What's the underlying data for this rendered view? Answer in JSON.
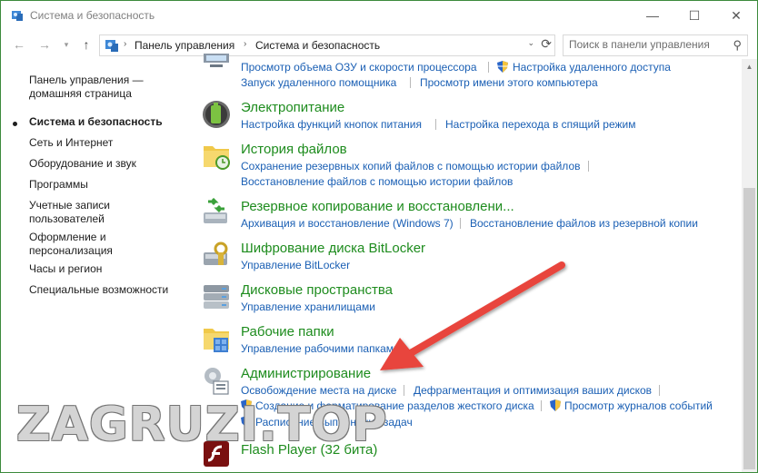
{
  "window": {
    "title": "Система и безопасность",
    "controls": {
      "minimize": "—",
      "maximize": "☐",
      "close": "✕"
    },
    "accent_border": "#3c8a3c"
  },
  "nav": {
    "back": "←",
    "forward": "→",
    "up": "↑",
    "breadcrumb": [
      "Панель управления",
      "Система и безопасность"
    ],
    "search_placeholder": "Поиск в панели управления"
  },
  "sidebar": {
    "items": [
      {
        "label_lines": [
          "Панель управления —",
          "домашняя страница"
        ],
        "active": false
      },
      {
        "label_lines": [
          "Система и безопасность"
        ],
        "active": true
      },
      {
        "label_lines": [
          "Сеть и Интернет"
        ],
        "active": false
      },
      {
        "label_lines": [
          "Оборудование и звук"
        ],
        "active": false
      },
      {
        "label_lines": [
          "Программы"
        ],
        "active": false
      },
      {
        "label_lines": [
          "Учетные записи",
          "пользователей"
        ],
        "active": false
      },
      {
        "label_lines": [
          "Оформление и",
          "персонализация"
        ],
        "active": false
      },
      {
        "label_lines": [
          "Часы и регион"
        ],
        "active": false
      },
      {
        "label_lines": [
          "Специальные возможности"
        ],
        "active": false
      }
    ]
  },
  "categories": [
    {
      "id": "system",
      "title": "",
      "icon": "system-monitor-icon",
      "links": [
        "Просмотр объема ОЗУ и скорости процессора",
        "Настройка удаленного доступа",
        "Запуск удаленного помощника",
        "Просмотр имени этого компьютера"
      ]
    },
    {
      "id": "power",
      "title": "Электропитание",
      "icon": "battery-icon",
      "links": [
        "Настройка функций кнопок питания",
        "Настройка перехода в спящий режим"
      ]
    },
    {
      "id": "file-history",
      "title": "История файлов",
      "icon": "file-history-icon",
      "links": [
        "Сохранение резервных копий файлов с помощью истории файлов",
        "Восстановление файлов с помощью истории файлов"
      ]
    },
    {
      "id": "backup",
      "title": "Резервное копирование и восстановлени...",
      "icon": "backup-restore-icon",
      "links": [
        "Архивация и восстановление (Windows 7)",
        "Восстановление файлов из резервной копии"
      ]
    },
    {
      "id": "bitlocker",
      "title": "Шифрование диска BitLocker",
      "icon": "bitlocker-icon",
      "links": [
        "Управление BitLocker"
      ]
    },
    {
      "id": "storage",
      "title": "Дисковые пространства",
      "icon": "storage-spaces-icon",
      "links": [
        "Управление хранилищами"
      ]
    },
    {
      "id": "work-folders",
      "title": "Рабочие папки",
      "icon": "work-folders-icon",
      "links": [
        "Управление рабочими папками"
      ]
    },
    {
      "id": "admin",
      "title": "Администрирование",
      "icon": "admin-tools-icon",
      "links": [
        "Освобождение места на диске",
        "Дефрагментация и оптимизация ваших дисков",
        "Создание и форматирование разделов жесткого диска",
        "Просмотр журналов событий",
        "Расписание выполнения задач"
      ]
    },
    {
      "id": "flash",
      "title": "Flash Player (32 бита)",
      "icon": "flash-player-icon",
      "links": []
    }
  ],
  "watermark": "ZAGRUZI.TOP",
  "colors": {
    "category_title": "#1e8c1e",
    "link": "#1a5fb4",
    "annotation_arrow": "#e8453c"
  }
}
